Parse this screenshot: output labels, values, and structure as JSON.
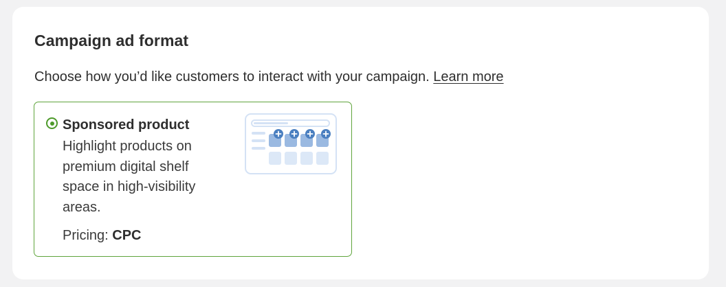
{
  "section": {
    "title": "Campaign ad format",
    "description": "Choose how you’d like customers to interact with your campaign.",
    "learn_more": "Learn more"
  },
  "option": {
    "title": "Sponsored product",
    "description": "Highlight products on premium digital shelf space in high-visibility areas.",
    "pricing_label": "Pricing:",
    "pricing_value": "CPC",
    "selected": true,
    "illustration_icon": "sponsored-shelf-illustration"
  },
  "colors": {
    "accent_green": "#4d9a2a",
    "option_border": "#5ea43b",
    "illustration_blue": "#4a7fc0",
    "illustration_light": "#d8e5f6"
  }
}
